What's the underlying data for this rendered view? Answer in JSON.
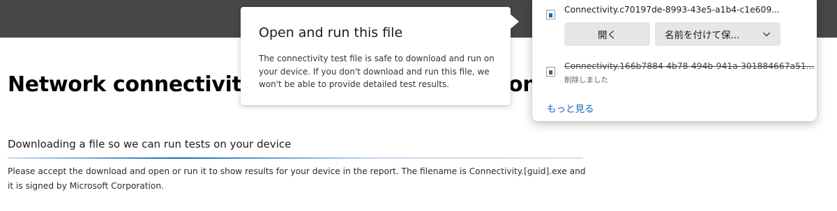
{
  "page": {
    "heading": "Network connectivity t",
    "heading_tail": "on",
    "section_title": "Downloading a file so we can run tests on your device",
    "body_text": "Please accept the download and open or run it to show results for your device in the report. The filename is Connectivity.[guid].exe and it is signed by Microsoft Corporation."
  },
  "callout": {
    "title": "Open and run this file",
    "text": "The connectivity test file is safe to download and run on your device. If you don't download and run this file, we won't be able to provide detailed test results."
  },
  "downloads": {
    "items": [
      {
        "name": "Connectivity.c70197de-8993-43e5-a1b4-c1e609...",
        "icon": "exe-file-icon",
        "actions": {
          "open": "開く",
          "save_as": "名前を付けて保..."
        }
      },
      {
        "name": "Connectivity.166b7884-4b78-494b-941a-301884667a51...",
        "icon": "exe-file-icon",
        "status": "削除しました"
      }
    ],
    "more_link": "もっと見る"
  },
  "colors": {
    "top_bar": "#474747",
    "accent": "#0f6cbd",
    "button_bg": "#e6e6e6"
  }
}
